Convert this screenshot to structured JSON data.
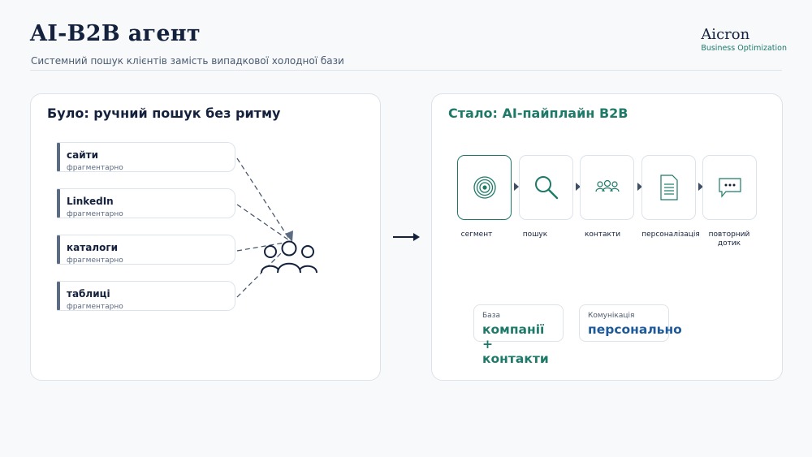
{
  "header": {
    "title": "AI-B2B агент",
    "subtitle": "Системний пошук клієнтів замість випадкової холодної бази",
    "brand_name": "Aicron",
    "brand_tagline": "Business Optimization"
  },
  "left_panel": {
    "title": "Було: ручний пошук без ритму",
    "sources": [
      {
        "label": "сайти",
        "sub": "фрагментарно"
      },
      {
        "label": "LinkedIn",
        "sub": "фрагментарно"
      },
      {
        "label": "каталоги",
        "sub": "фрагментарно"
      },
      {
        "label": "таблиці",
        "sub": "фрагментарно"
      }
    ],
    "target_icon": "people-group-icon"
  },
  "right_panel": {
    "title": "Стало: AI-пайплайн B2B",
    "steps": [
      {
        "label": "сегмент",
        "icon": "target-icon"
      },
      {
        "label": "пошук",
        "icon": "magnifier-icon"
      },
      {
        "label": "контакти",
        "icon": "people-icon"
      },
      {
        "label": "персоналізація",
        "icon": "document-icon"
      },
      {
        "label": "повторний дотик",
        "icon": "chat-bubble-icon"
      }
    ],
    "stats": [
      {
        "label": "База",
        "value": "компанії + контакти"
      },
      {
        "label": "Комунікація",
        "value": "персонально"
      }
    ]
  },
  "colors": {
    "navy": "#14213d",
    "teal": "#1e7a68",
    "blue": "#1e5a9a",
    "slate": "#5b6b82"
  }
}
